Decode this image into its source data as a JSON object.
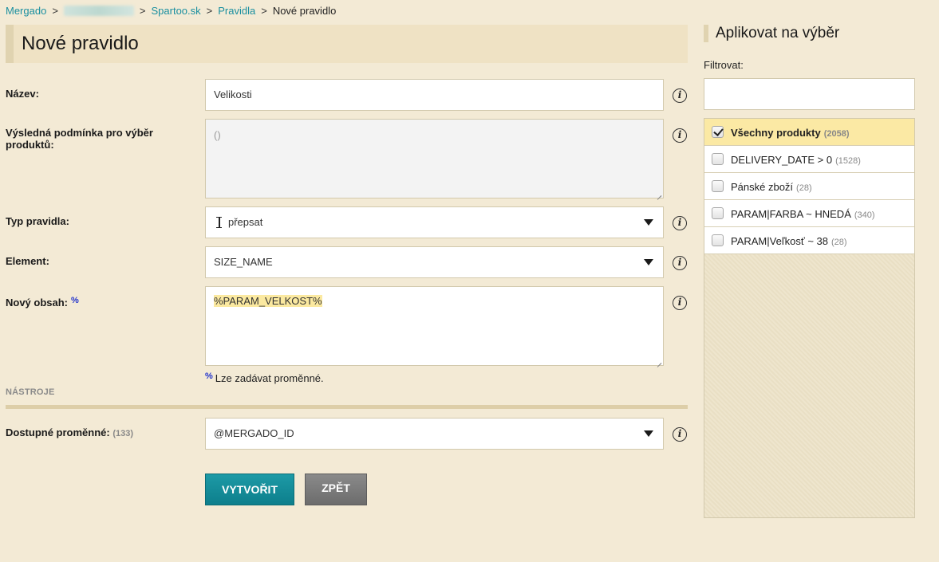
{
  "breadcrumb": {
    "items": [
      "Mergado",
      "Spartoo.sk",
      "Pravidla"
    ],
    "separator": ">",
    "current": "Nové pravidlo"
  },
  "page_title": "Nové pravidlo",
  "form": {
    "name": {
      "label": "Název:",
      "value": "Velikosti"
    },
    "condition": {
      "label": "Výsledná podmínka pro výběr produktů:",
      "value": "()"
    },
    "rule_type": {
      "label": "Typ pravidla:",
      "value": "přepsat"
    },
    "element": {
      "label": "Element:",
      "value": "SIZE_NAME"
    },
    "new_content": {
      "label": "Nový obsah:",
      "marker": "%",
      "value": "%PARAM_VELKOST%"
    },
    "hint": {
      "marker": "%",
      "text": "Lze zadávat proměnné."
    },
    "tools_title": "NÁSTROJE",
    "variables": {
      "label": "Dostupné proměnné:",
      "count": "(133)",
      "value": "@MERGADO_ID"
    },
    "create_button": "VYTVOŘIT",
    "back_button": "ZPĚT"
  },
  "sidebar": {
    "title": "Aplikovat na výběr",
    "filter_label": "Filtrovat:",
    "filter_value": "",
    "items": [
      {
        "label": "Všechny produkty",
        "count": "(2058)",
        "checked": true
      },
      {
        "label": "DELIVERY_DATE > 0",
        "count": "(1528)",
        "checked": false
      },
      {
        "label": "Pánské zboží",
        "count": "(28)",
        "checked": false
      },
      {
        "label": "PARAM|FARBA ~ HNEDÁ",
        "count": "(340)",
        "checked": false
      },
      {
        "label": "PARAM|Veľkosť ~ 38",
        "count": "(28)",
        "checked": false
      }
    ]
  },
  "icons": {
    "info": "info-icon",
    "dropdown": "chevron-down-icon",
    "checkbox": "checkbox-icon",
    "text_cursor": "text-cursor-icon"
  },
  "colors": {
    "accent": "#1a8fa0",
    "background": "#f3ead5",
    "create_button": "#0d7f8c",
    "back_button": "#757575",
    "selected_item": "#fbe9a4"
  }
}
